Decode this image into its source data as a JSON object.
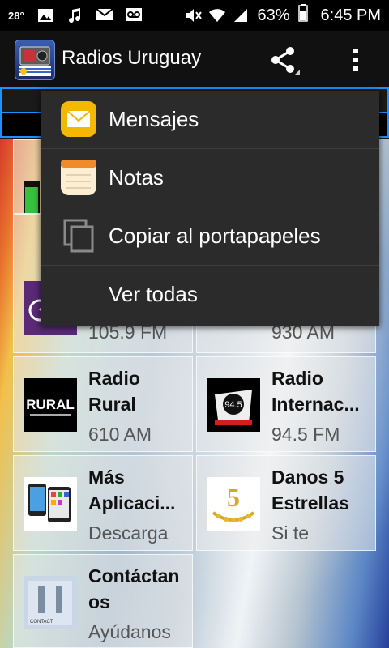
{
  "status_bar": {
    "temperature": "28°",
    "battery": "63%",
    "time": "6:45 PM"
  },
  "app_bar": {
    "title": "Radios Uruguay",
    "share_icon": "share-icon",
    "more_icon": "more-vert-icon"
  },
  "grid": [
    {
      "title": "",
      "sub": "105.9 FM",
      "thumb": "logo-purple",
      "partial_top": true
    },
    {
      "title": "",
      "sub": "930 AM",
      "thumb": "logo-cx30",
      "partial_top": true
    },
    {
      "title": "Radio\nRural",
      "sub": "610 AM",
      "thumb": "logo-rural"
    },
    {
      "title": "Radio\nInternac...",
      "sub": "94.5 FM",
      "thumb": "logo-internacional"
    },
    {
      "title": "Más\nAplicaci...",
      "sub": "Descarga",
      "thumb": "logo-phones"
    },
    {
      "title": "Danos 5\nEstrellas",
      "sub": "Si te",
      "thumb": "logo-stars"
    },
    {
      "title": "Contáctan\nos",
      "sub": "Ayúdanos",
      "thumb": "logo-contact"
    }
  ],
  "share_menu": {
    "items": [
      {
        "label": "Mensajes",
        "icon": "mail-icon"
      },
      {
        "label": "Notas",
        "icon": "notes-icon"
      },
      {
        "label": "Copiar al portapapeles",
        "icon": "copy-icon"
      },
      {
        "label": "Ver todas",
        "icon": ""
      }
    ]
  }
}
